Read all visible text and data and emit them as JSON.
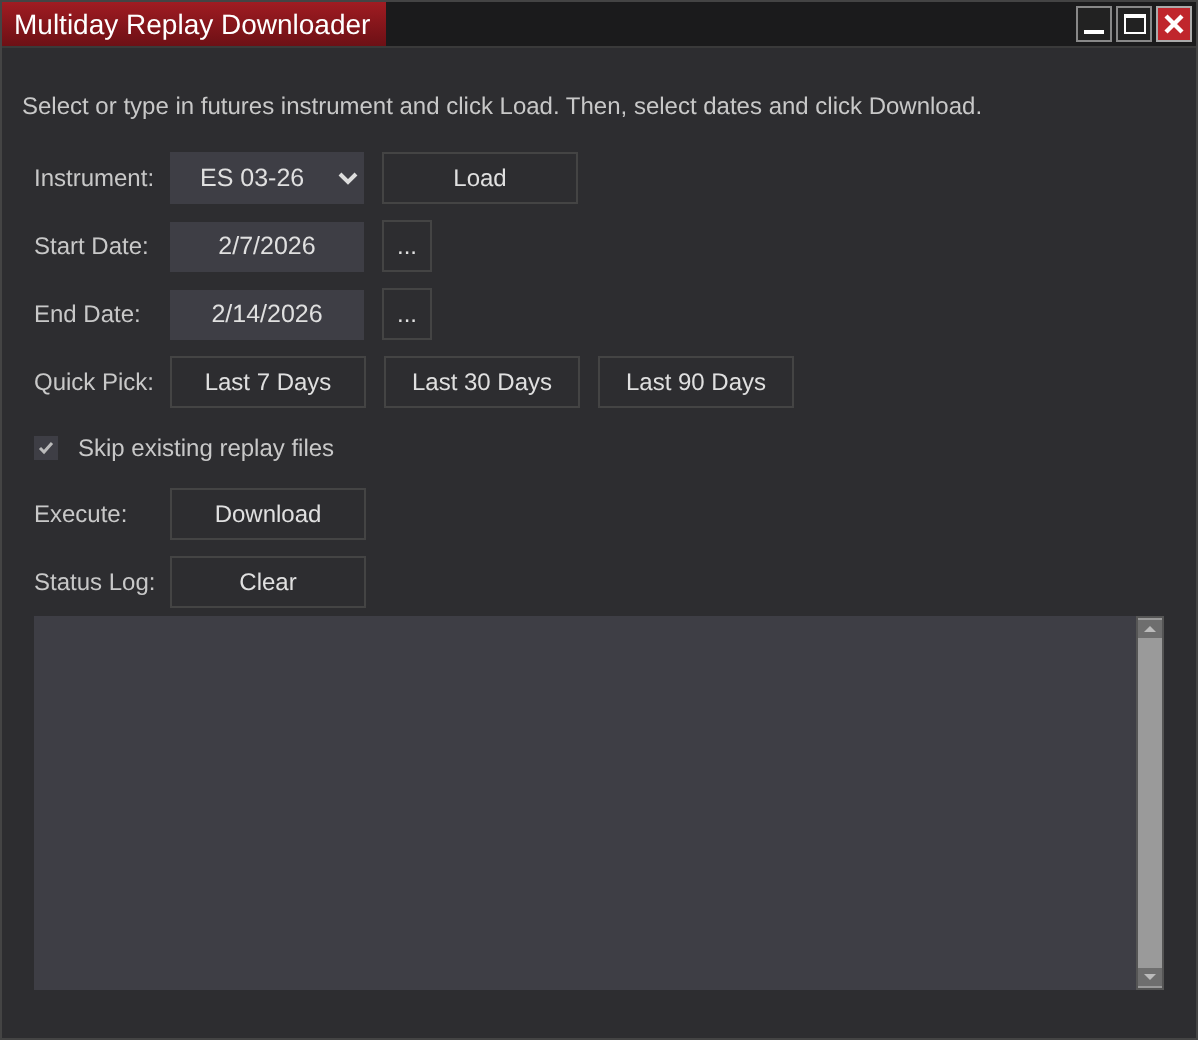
{
  "window": {
    "title": "Multiday Replay Downloader"
  },
  "instructions": "Select or type in futures instrument and click Load. Then, select dates and click Download.",
  "instrument": {
    "label": "Instrument:",
    "value": "ES 03-26",
    "button": "Load"
  },
  "start_date": {
    "label": "Start Date:",
    "value": "2/7/2026",
    "button": "..."
  },
  "end_date": {
    "label": "End Date:",
    "value": "2/14/2026",
    "button": "..."
  },
  "quick_pick": {
    "label": "Quick Pick:",
    "buttons": [
      "Last 7 Days",
      "Last 30 Days",
      "Last 90 Days"
    ]
  },
  "skip_existing": {
    "label": "Skip existing replay files",
    "checked": true
  },
  "execute": {
    "label": "Execute:",
    "button": "Download"
  },
  "status_log": {
    "label": "Status Log:",
    "button": "Clear"
  }
}
